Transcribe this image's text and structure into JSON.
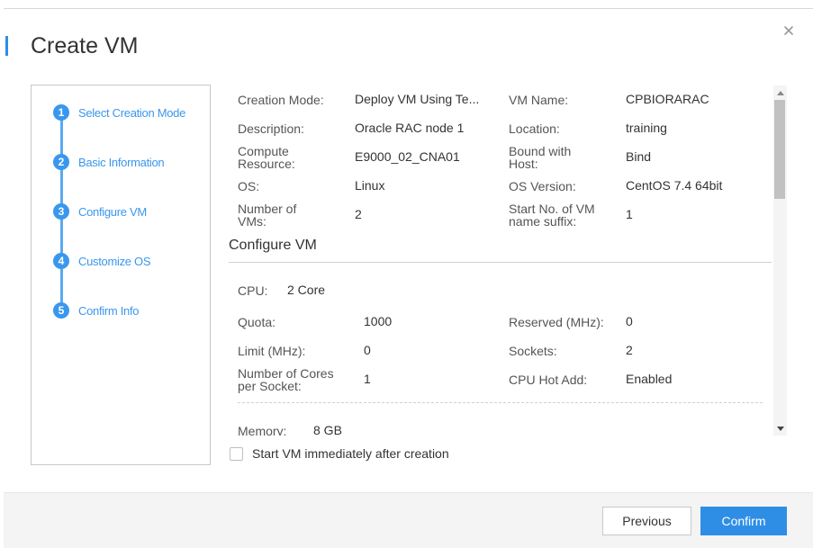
{
  "dialog": {
    "title": "Create VM",
    "accent_color": "#2e8ee6"
  },
  "steps": [
    {
      "num": "1",
      "label": "Select Creation Mode"
    },
    {
      "num": "2",
      "label": "Basic Information"
    },
    {
      "num": "3",
      "label": "Configure VM"
    },
    {
      "num": "4",
      "label": "Customize OS"
    },
    {
      "num": "5",
      "label": "Confirm Info"
    }
  ],
  "summary": {
    "creation_mode": {
      "label": "Creation Mode:",
      "value": "Deploy VM Using Te..."
    },
    "vm_name": {
      "label": "VM Name:",
      "value": "CPBIORARAC"
    },
    "description": {
      "label": "Description:",
      "value": "Oracle RAC node 1"
    },
    "location": {
      "label": "Location:",
      "value": "training"
    },
    "compute_resource": {
      "label_line1": "Compute",
      "label_line2": "Resource:",
      "value": "E9000_02_CNA01"
    },
    "bound_with_host": {
      "label_line1": "Bound with",
      "label_line2": "Host:",
      "value": "Bind"
    },
    "os": {
      "label": "OS:",
      "value": "Linux"
    },
    "os_version": {
      "label": "OS Version:",
      "value": "CentOS 7.4 64bit"
    },
    "number_of_vms": {
      "label_line1": "Number of",
      "label_line2": "VMs:",
      "value": "2"
    },
    "start_no": {
      "label_line1": "Start No. of VM",
      "label_line2": "name suffix:",
      "value": "1"
    }
  },
  "configure_vm": {
    "section_title": "Configure VM",
    "cpu": {
      "label": "CPU:",
      "value": "2 Core"
    },
    "quota": {
      "label": "Quota:",
      "value": "1000"
    },
    "reserved": {
      "label": "Reserved (MHz):",
      "value": "0"
    },
    "limit": {
      "label": "Limit (MHz):",
      "value": "0"
    },
    "sockets": {
      "label": "Sockets:",
      "value": "2"
    },
    "cores_per_socket": {
      "label_line1": "Number of Cores",
      "label_line2": "per Socket:",
      "value": "1"
    },
    "cpu_hot_add": {
      "label": "CPU Hot Add:",
      "value": "Enabled"
    },
    "memory": {
      "label": "Memory:",
      "value": "8 GB"
    }
  },
  "start_immediately": {
    "label": "Start VM immediately after creation",
    "checked": false
  },
  "footer": {
    "previous_label": "Previous",
    "confirm_label": "Confirm"
  }
}
